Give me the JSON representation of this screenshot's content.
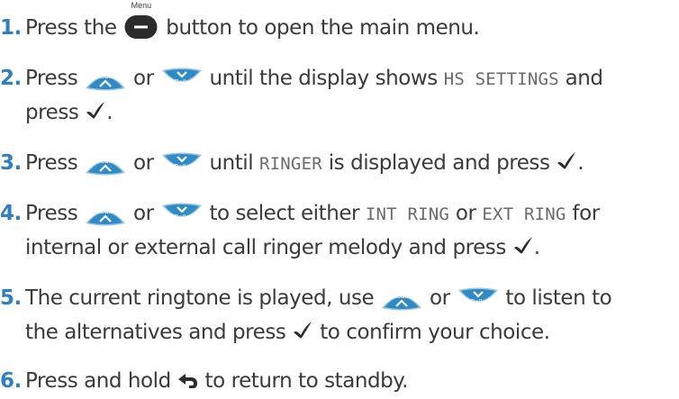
{
  "steps": [
    {
      "number": "1.",
      "t1": "Press the",
      "menu_label": "Menu",
      "t2": "button to open the main menu."
    },
    {
      "number": "2.",
      "t1": "Press",
      "redial_label": "Redial",
      "t2": "or",
      "calls_label": "Calls",
      "t3": "until the display shows",
      "lcd1": "HS SETTINGS",
      "t4": "and",
      "t5": "press",
      "t6": "."
    },
    {
      "number": "3.",
      "t1": "Press",
      "redial_label": "Redial",
      "t2": "or",
      "calls_label": "Calls",
      "t3": "until",
      "lcd1": "RINGER",
      "t4": "is displayed and press",
      "t5": "."
    },
    {
      "number": "4.",
      "t1": "Press",
      "redial_label": "Redial",
      "t2": "or",
      "calls_label": "Calls",
      "t3": "to select either",
      "lcd1": "INT RING",
      "t4": "or",
      "lcd2": "EXT RING",
      "t5": "for",
      "t6": "internal or external call ringer melody and press",
      "t7": "."
    },
    {
      "number": "5.",
      "t1": "The current ringtone is played, use",
      "redial_label": "Redial",
      "t2": "or",
      "calls_label": "Calls",
      "t3": "to listen to",
      "t4": "the alternatives and press",
      "t5": "to confirm your choice."
    },
    {
      "number": "6.",
      "t1": "Press and hold",
      "t2": "to return to standby."
    }
  ],
  "colors": {
    "number": "#2f7fc1",
    "text": "#3a3a3a",
    "key_face": "#2e8bc6",
    "key_rim": "#9ac4e2"
  },
  "icons": [
    "menu-key-icon",
    "redial-up-key-icon",
    "calls-down-key-icon",
    "tick-icon",
    "back-arrow-icon"
  ]
}
